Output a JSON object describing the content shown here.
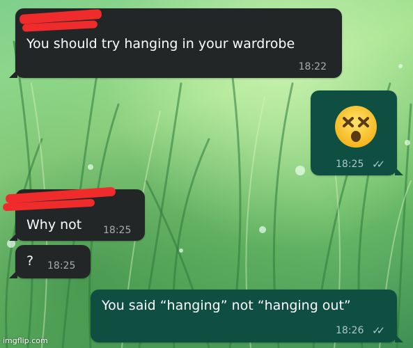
{
  "messages": [
    {
      "direction": "incoming",
      "sender_redacted": true,
      "text": "You should try hanging in your wardrobe",
      "time": "18:22"
    },
    {
      "direction": "outgoing",
      "emoji": "dizzy-face-emoji",
      "time": "18:25",
      "status": "read-double-check"
    },
    {
      "direction": "incoming",
      "sender_redacted": true,
      "text": "Why not",
      "time": "18:25"
    },
    {
      "direction": "incoming",
      "text": "?",
      "time": "18:25"
    },
    {
      "direction": "outgoing",
      "text": "You said “hanging” not “hanging out”",
      "time": "18:26",
      "status": "read-double-check"
    }
  ],
  "watermark": "imgflip.com",
  "colors": {
    "incoming_bubble": "#232626",
    "outgoing_bubble": "#0f4f42",
    "redaction": "#ef2b2b",
    "timestamp": "#a6adab"
  }
}
